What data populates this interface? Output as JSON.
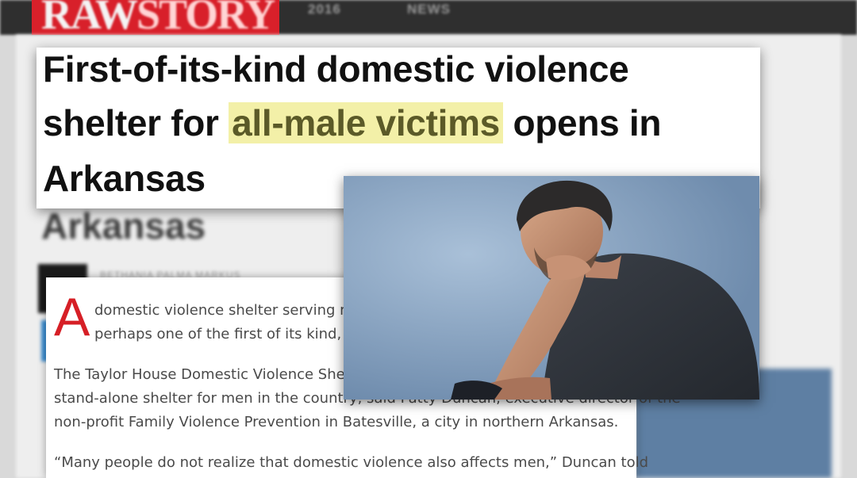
{
  "site": {
    "logo_raw": "RAW",
    "logo_story": "STORY",
    "nav": [
      "2016",
      "NEWS"
    ]
  },
  "headline": {
    "line1": "First-of-its-kind domestic violence",
    "line2_before": "shelter for ",
    "line2_highlight": "all-male victims",
    "line2_after": " opens in",
    "line3": "Arkansas",
    "ghost_repeat": "Arkansas"
  },
  "byline": {
    "author": "BETHANIA PALMA MARKUS"
  },
  "article": {
    "drop_cap": "A",
    "line1": "domestic violence shelter serving mal",
    "line2": "perhaps one of the first of its kind, acc",
    "line3": "The Taylor House Domestic Violence Shelte",
    "line4": "stand-alone shelter for men in the country, said Patty Duncan, executive director of the",
    "line5": "non-profit Family Violence Prevention in Batesville, a city in northern Arkansas.",
    "line6": "“Many people do not realize that domestic violence also affects men,” Duncan told"
  },
  "colors": {
    "brand_red": "#d8202a",
    "highlight_yellow": "#f3f0a8",
    "drop_cap_red": "#d61f26"
  }
}
